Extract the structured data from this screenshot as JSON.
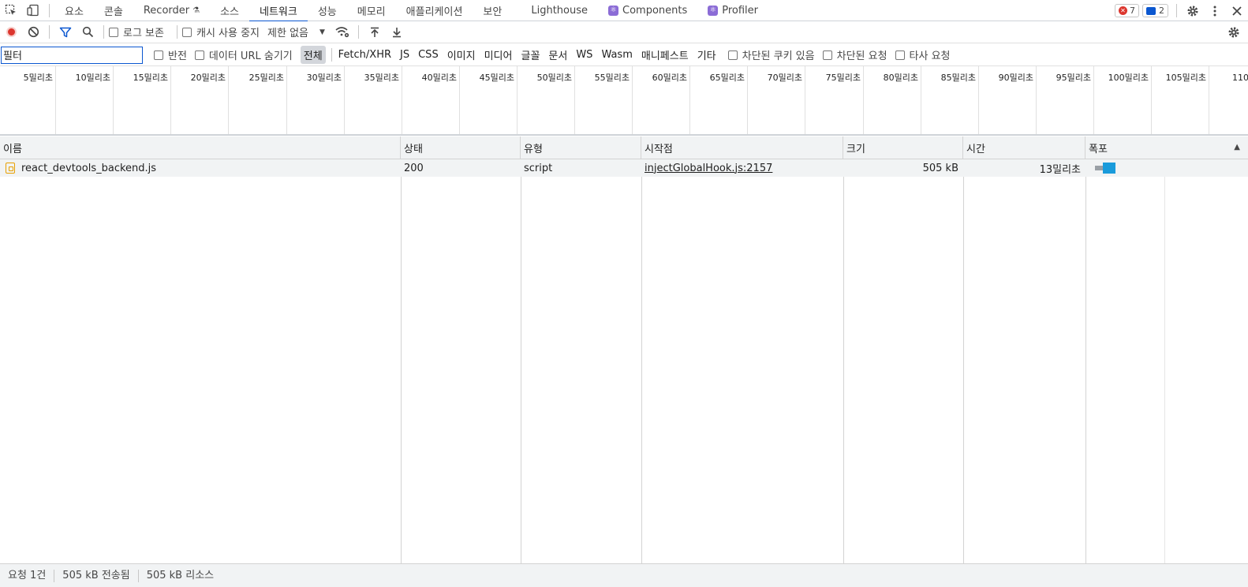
{
  "toolbar": {
    "tabs": [
      {
        "label": "요소"
      },
      {
        "label": "콘솔"
      },
      {
        "label": "Recorder"
      },
      {
        "label": "소스"
      },
      {
        "label": "네트워크"
      },
      {
        "label": "성능"
      },
      {
        "label": "메모리"
      },
      {
        "label": "애플리케이션"
      },
      {
        "label": "보안"
      },
      {
        "label": "Lighthouse"
      },
      {
        "label": "Components"
      },
      {
        "label": "Profiler"
      }
    ],
    "error_count": "7",
    "message_count": "2"
  },
  "network_toolbar": {
    "preserve_log": "로그 보존",
    "disable_cache": "캐시 사용 중지",
    "throttling": "제한 없음"
  },
  "filter_bar": {
    "placeholder": "필터",
    "value": "필터",
    "invert": "반전",
    "hide_data_urls": "데이터 URL 숨기기",
    "types": [
      "전체",
      "Fetch/XHR",
      "JS",
      "CSS",
      "이미지",
      "미디어",
      "글꼴",
      "문서",
      "WS",
      "Wasm",
      "매니페스트",
      "기타"
    ],
    "blocked_cookies": "차단된 쿠키 있음",
    "blocked_requests": "차단된 요청",
    "third_party": "타사 요청"
  },
  "overview": {
    "ticks": [
      "5밀리초",
      "10밀리초",
      "15밀리초",
      "20밀리초",
      "25밀리초",
      "30밀리초",
      "35밀리초",
      "40밀리초",
      "45밀리초",
      "50밀리초",
      "55밀리초",
      "60밀리초",
      "65밀리초",
      "70밀리초",
      "75밀리초",
      "80밀리초",
      "85밀리초",
      "90밀리초",
      "95밀리초",
      "100밀리초",
      "105밀리초",
      "110밀리"
    ]
  },
  "table": {
    "columns": {
      "name": "이름",
      "status": "상태",
      "type": "유형",
      "initiator": "시작점",
      "size": "크기",
      "time": "시간",
      "waterfall": "폭포"
    },
    "rows": [
      {
        "name": "react_devtools_backend.js",
        "status": "200",
        "type": "script",
        "initiator": "injectGlobalHook.js:2157",
        "size": "505 kB",
        "time": "13밀리초"
      }
    ]
  },
  "status_bar": {
    "requests": "요청 1건",
    "transferred": "505 kB 전송됨",
    "resources": "505 kB 리소스"
  },
  "colors": {
    "accent": "#0b57d0",
    "record": "#dc362e",
    "waterfall_receive": "#1a9bdb"
  }
}
